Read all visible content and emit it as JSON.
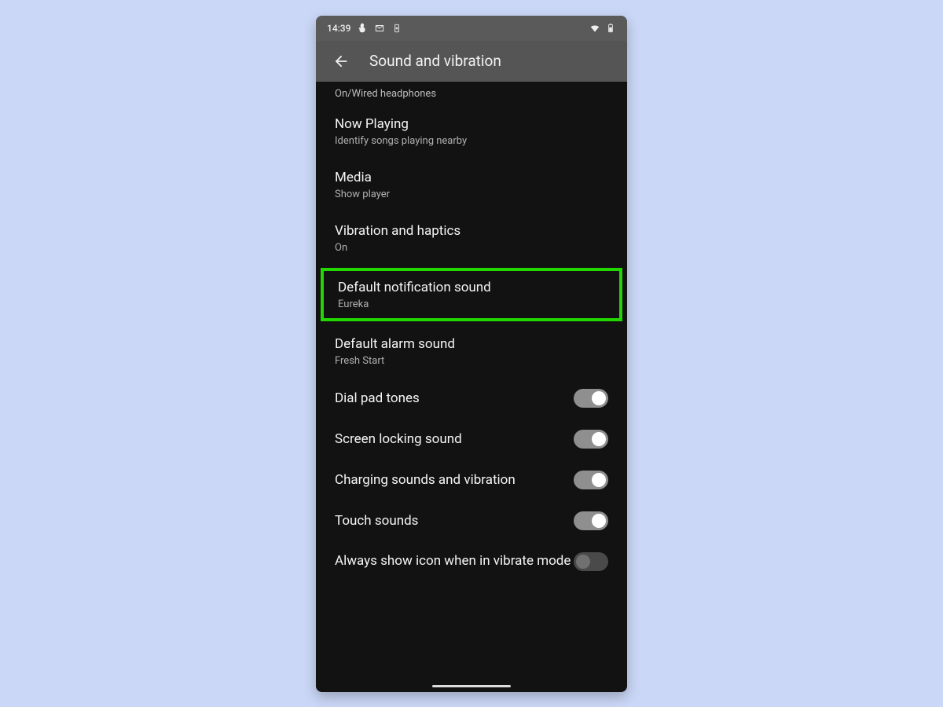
{
  "statusbar": {
    "time": "14:39"
  },
  "appbar": {
    "title": "Sound and vibration"
  },
  "partial": {
    "sub": "On/Wired headphones"
  },
  "items": [
    {
      "title": "Now Playing",
      "sub": "Identify songs playing nearby"
    },
    {
      "title": "Media",
      "sub": "Show player"
    },
    {
      "title": "Vibration and haptics",
      "sub": "On"
    },
    {
      "title": "Default notification sound",
      "sub": "Eureka",
      "highlight": true
    },
    {
      "title": "Default alarm sound",
      "sub": "Fresh Start"
    },
    {
      "title": "Dial pad tones",
      "toggle": "on"
    },
    {
      "title": "Screen locking sound",
      "toggle": "on"
    },
    {
      "title": "Charging sounds and vibration",
      "toggle": "on"
    },
    {
      "title": "Touch sounds",
      "toggle": "on"
    },
    {
      "title": "Always show icon when in vibrate mode",
      "toggle": "off"
    }
  ],
  "colors": {
    "highlight": "#22d600",
    "backdrop": "#cad7f6",
    "surface": "#121212"
  }
}
